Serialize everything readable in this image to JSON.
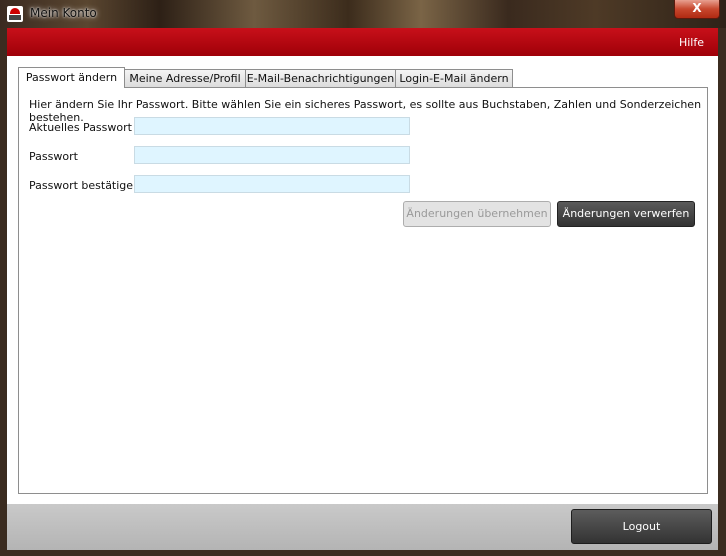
{
  "window": {
    "title": "Mein Konto",
    "close_label": "X"
  },
  "header": {
    "help_label": "Hilfe"
  },
  "tabs": [
    {
      "label": "Passwort ändern",
      "active": true
    },
    {
      "label": "Meine Adresse/Profil",
      "active": false
    },
    {
      "label": "E-Mail-Benachrichtigungen",
      "active": false
    },
    {
      "label": "Login-E-Mail ändern",
      "active": false
    }
  ],
  "form": {
    "intro": "Hier ändern Sie Ihr Passwort. Bitte wählen Sie ein sicheres Passwort, es sollte aus Buchstaben, Zahlen und Sonderzeichen bestehen.",
    "fields": [
      {
        "label": "Aktuelles Passwort",
        "value": ""
      },
      {
        "label": "Passwort",
        "value": ""
      },
      {
        "label": "Passwort bestätigen",
        "value": ""
      }
    ],
    "apply_label": "Änderungen übernehmen",
    "discard_label": "Änderungen verwerfen"
  },
  "footer": {
    "logout_label": "Logout"
  },
  "colors": {
    "accent": "#b00010",
    "field_bg": "#dff5ff"
  }
}
